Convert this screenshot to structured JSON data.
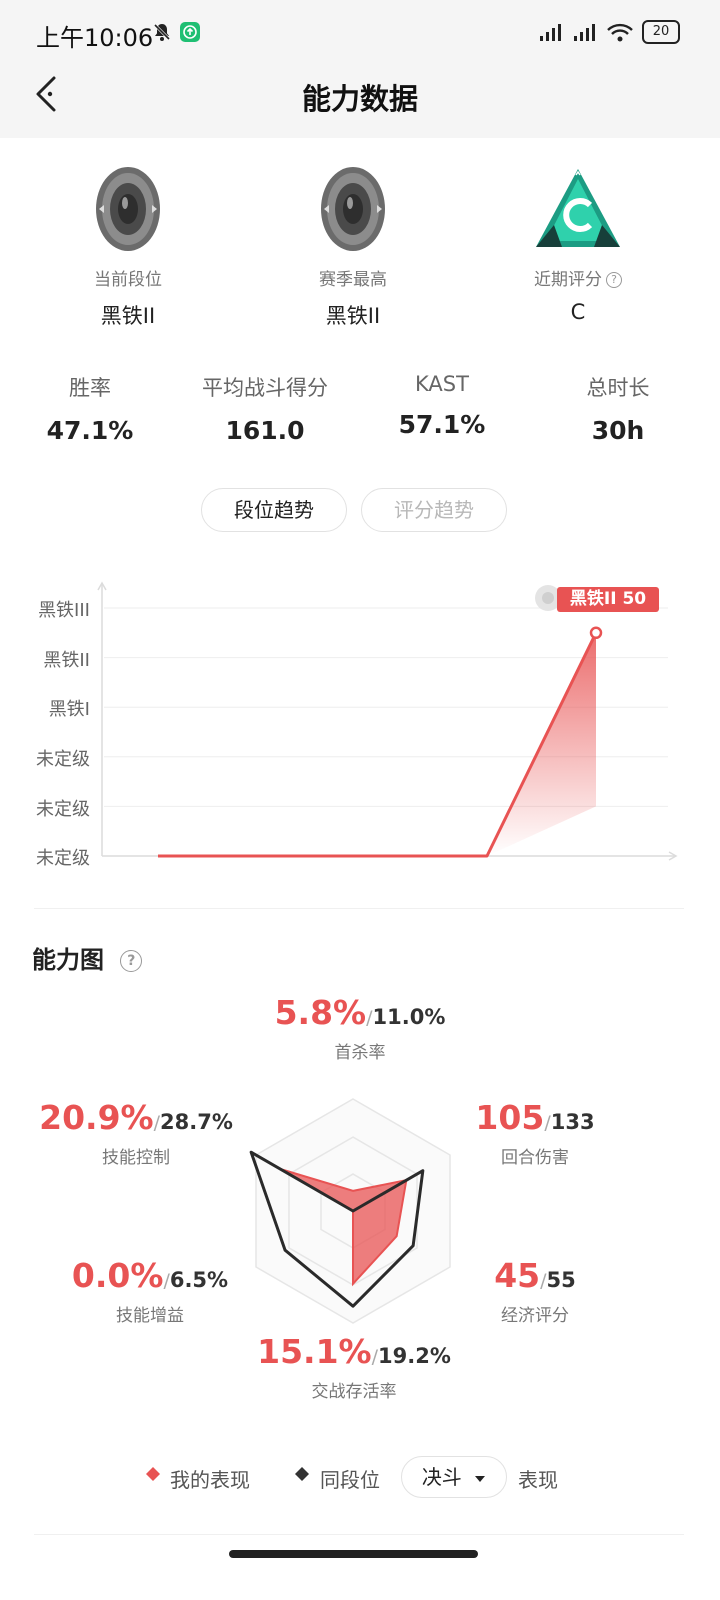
{
  "status_bar": {
    "time": "上午10:06",
    "battery": "20"
  },
  "header": {
    "title": "能力数据"
  },
  "ranks": [
    {
      "label": "当前段位",
      "value": "黑铁II"
    },
    {
      "label": "赛季最高",
      "value": "黑铁II"
    },
    {
      "label": "近期评分",
      "value": "C"
    }
  ],
  "stats": [
    {
      "label": "胜率",
      "value": "47.1%"
    },
    {
      "label": "平均战斗得分",
      "value": "161.0"
    },
    {
      "label": "KAST",
      "value": "57.1%"
    },
    {
      "label": "总时长",
      "value": "30h"
    }
  ],
  "trend_tabs": {
    "rank_trend": "段位趋势",
    "score_trend": "评分趋势",
    "active": "段位趋势"
  },
  "chart_data": {
    "type": "line",
    "y_tick_labels": [
      "未定级",
      "未定级",
      "未定级",
      "黑铁I",
      "黑铁II",
      "黑铁III"
    ],
    "series": [
      {
        "values": [
          0,
          0,
          0,
          0,
          4.5
        ]
      }
    ],
    "latest_tag": "黑铁II 50",
    "line_color": "#e85353"
  },
  "ability_chart": {
    "title": "能力图",
    "axes": [
      {
        "label": "首杀率",
        "mine": "5.8%",
        "peer": "11.0%"
      },
      {
        "label": "回合伤害",
        "mine": "105",
        "peer": "133"
      },
      {
        "label": "经济评分",
        "mine": "45",
        "peer": "55"
      },
      {
        "label": "交战存活率",
        "mine": "15.1%",
        "peer": "19.2%"
      },
      {
        "label": "技能增益",
        "mine": "0.0%",
        "peer": "6.5%"
      },
      {
        "label": "技能控制",
        "mine": "20.9%",
        "peer": "28.7%"
      }
    ],
    "mine_normalized": [
      0.18,
      0.55,
      0.45,
      0.65,
      0.0,
      0.75
    ],
    "peer_normalized": [
      0.0,
      0.72,
      0.62,
      0.85,
      0.7,
      1.05
    ]
  },
  "legend": {
    "mine": "我的表现",
    "peer": "同段位",
    "mode": "决斗",
    "suffix": "表现",
    "mine_color": "#e85353",
    "peer_color": "#333333"
  }
}
